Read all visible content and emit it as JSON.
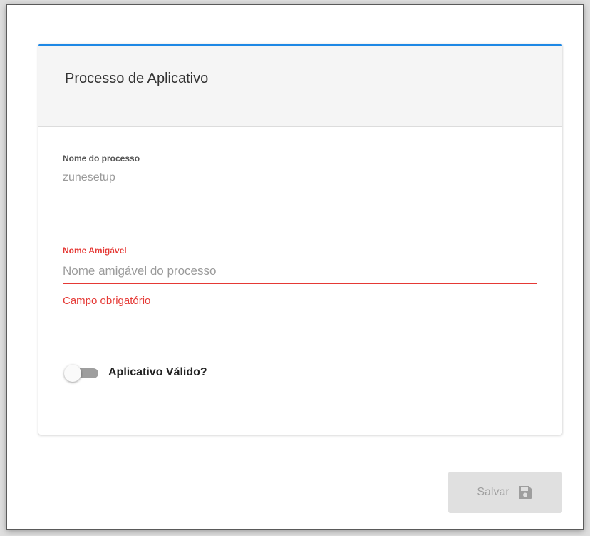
{
  "card": {
    "title": "Processo de Aplicativo",
    "accent_color": "#1e88e5"
  },
  "process_name": {
    "label": "Nome do processo",
    "value": "zunesetup"
  },
  "friendly_name": {
    "label": "Nome Amigável",
    "value": "",
    "placeholder": "Nome amigável do processo",
    "error": "Campo obrigatório",
    "error_color": "#e53935"
  },
  "valid_app": {
    "label": "Aplicativo Válido?",
    "checked": false
  },
  "actions": {
    "save_label": "Salvar",
    "save_icon": "floppy-disk-icon",
    "save_disabled": true
  }
}
